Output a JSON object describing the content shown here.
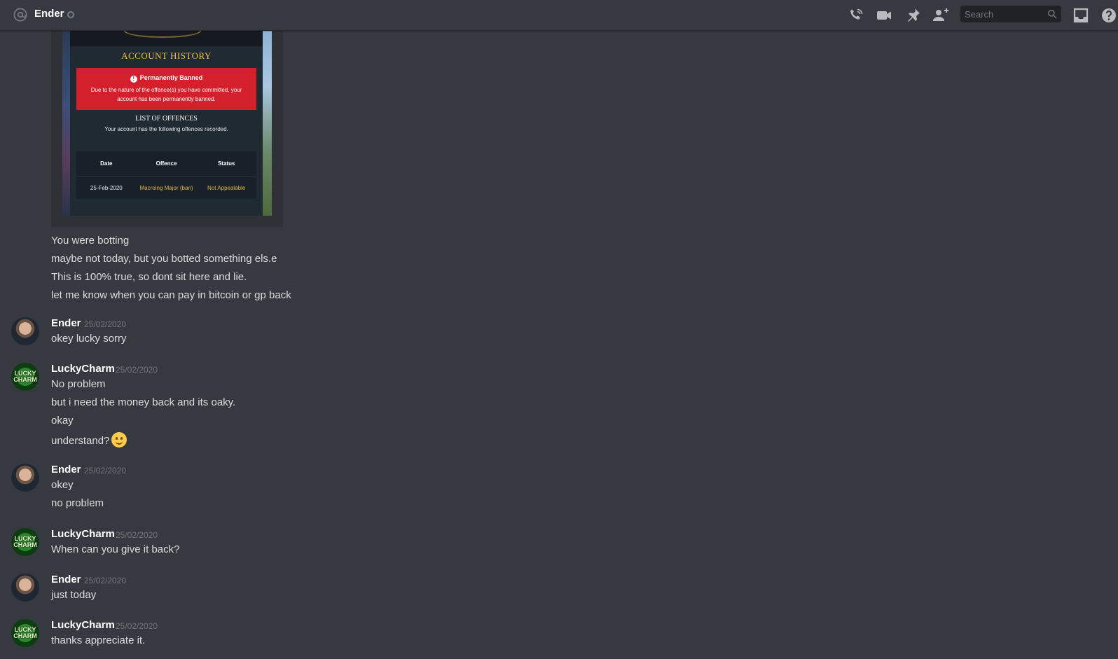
{
  "header": {
    "channel_name": "Ender",
    "search_placeholder": "Search",
    "icons": [
      "at-icon",
      "status-idle-icon",
      "call-icon",
      "video-icon",
      "pin-icon",
      "add-friend-icon",
      "search-icon",
      "inbox-icon",
      "help-icon"
    ]
  },
  "embed": {
    "title": "ACCOUNT HISTORY",
    "ban_title": "Permanently Banned",
    "ban_text": "Due to the nature of the offence(s) you have committed, your account has been permanently banned.",
    "offences_title": "LIST OF OFFENCES",
    "offences_sub": "Your account has the following offences recorded.",
    "columns": [
      "Date",
      "Offence",
      "Status"
    ],
    "rows": [
      [
        "25-Feb-2020",
        "Macroing Major (ban)",
        "Not Appealable"
      ]
    ]
  },
  "messages": {
    "first_group_lines": [
      "You were botting",
      "maybe not today, but you botted something els.e",
      "This is 100% true, so dont sit here and lie.",
      "let me know when you can pay in bitcoin or gp back"
    ],
    "groups": [
      {
        "author": "Ender",
        "time": "25/02/2020",
        "lines": [
          "okey lucky sorry"
        ]
      },
      {
        "author": "LuckyCharm",
        "time": "25/02/2020",
        "lines": [
          "No problem",
          "but i need the money back and its oaky.",
          "okay",
          "understand?"
        ]
      },
      {
        "author": "Ender",
        "time": "25/02/2020",
        "lines": [
          "okey",
          "no problem"
        ]
      },
      {
        "author": "LuckyCharm",
        "time": "25/02/2020",
        "lines": [
          "When can you give it back?"
        ]
      },
      {
        "author": "Ender",
        "time": "25/02/2020",
        "lines": [
          "just today"
        ]
      },
      {
        "author": "LuckyCharm",
        "time": "25/02/2020",
        "lines": [
          "thanks appreciate it."
        ]
      }
    ],
    "avatar_texts": {
      "lucky": "LUCKY CHARM"
    },
    "emoji": "slight-smile-emoji"
  },
  "colors": {
    "background": "#36393f",
    "text": "#dcddde",
    "timestamp": "#72767d",
    "author": "#ffffff",
    "ban_red": "#d4202c",
    "gold": "#f0c040"
  }
}
